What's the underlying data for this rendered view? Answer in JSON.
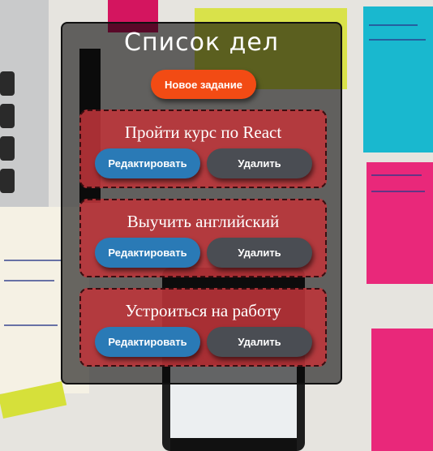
{
  "app": {
    "title": "Список дел",
    "new_task_label": "Новое задание"
  },
  "tasks": [
    {
      "title": "Пройти курс по React",
      "edit_label": "Редактировать",
      "delete_label": "Удалить"
    },
    {
      "title": "Выучить английский",
      "edit_label": "Редактировать",
      "delete_label": "Удалить"
    },
    {
      "title": "Устроиться на работу",
      "edit_label": "Редактировать",
      "delete_label": "Удалить"
    }
  ],
  "colors": {
    "new_task_button": "#f24b14",
    "task_card": "#be343a",
    "edit_button": "#2a7ab6",
    "delete_button": "#4a4d53"
  }
}
